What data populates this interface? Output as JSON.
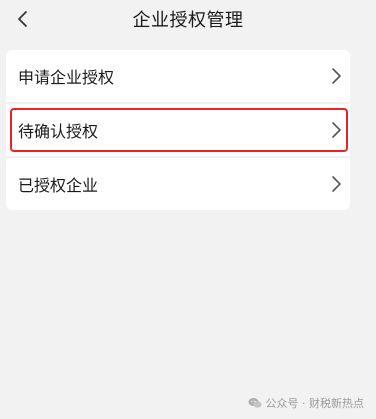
{
  "header": {
    "title": "企业授权管理",
    "back_icon": "chevron-left-icon"
  },
  "menu": {
    "items": [
      {
        "label": "申请企业授权",
        "highlighted": false
      },
      {
        "label": "待确认授权",
        "highlighted": true
      },
      {
        "label": "已授权企业",
        "highlighted": false
      }
    ]
  },
  "watermark": {
    "text": "公众号 · 财税新热点",
    "icon": "wechat-icon"
  },
  "colors": {
    "background": "#f2f2f2",
    "card": "#ffffff",
    "highlight": "#e8232a"
  }
}
